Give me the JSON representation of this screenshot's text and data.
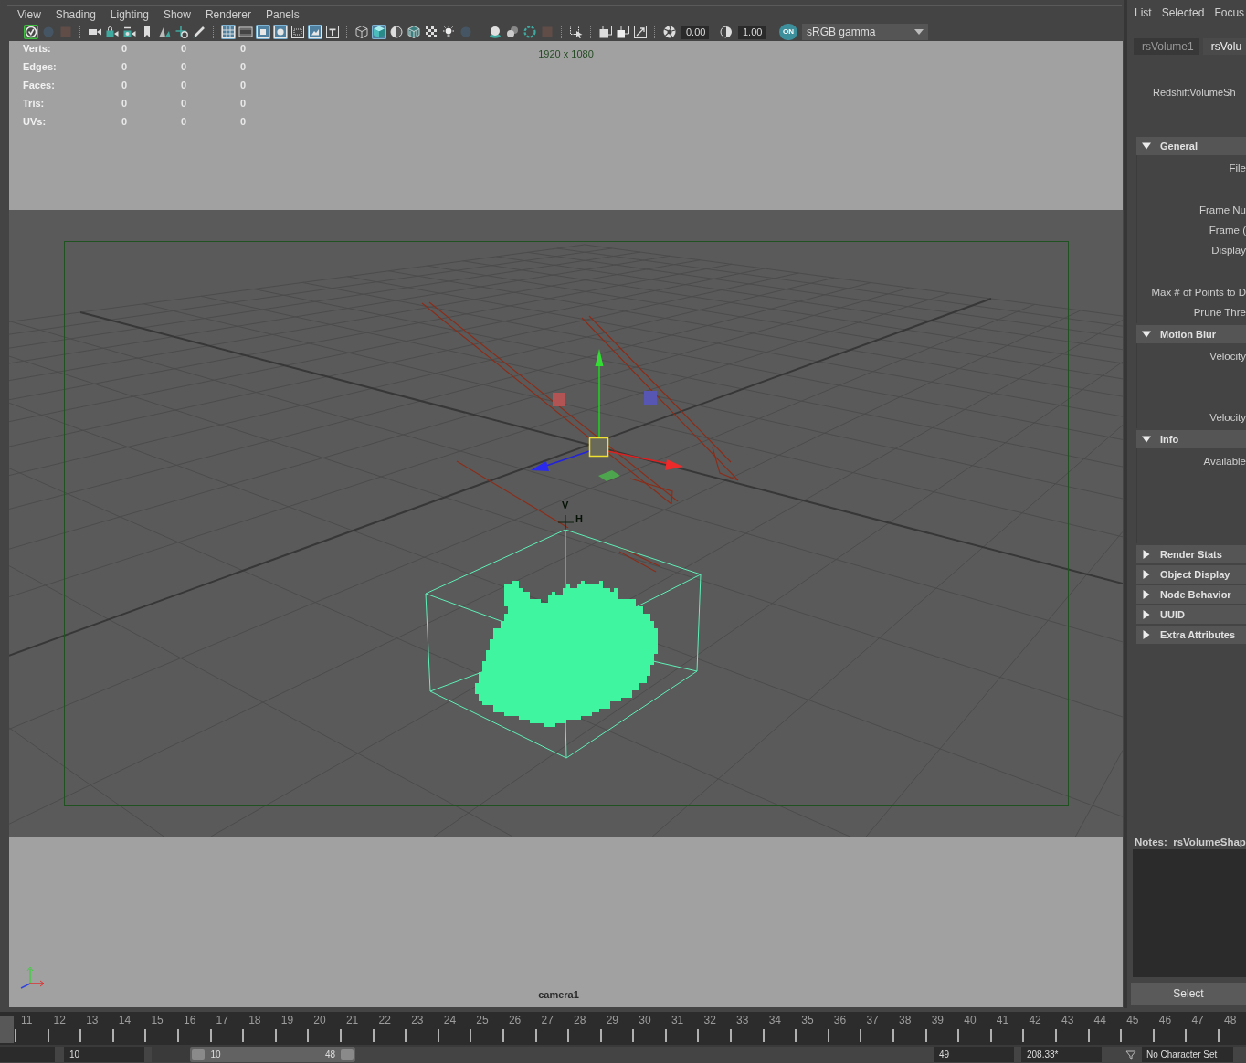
{
  "viewport": {
    "menu": [
      "View",
      "Shading",
      "Lighting",
      "Show",
      "Renderer",
      "Panels"
    ],
    "toolbar": {
      "groups": [
        [
          {
            "kind": "select-camera",
            "on": true,
            "disabled": false
          },
          {
            "kind": "dot",
            "on": false,
            "disabled": true
          },
          {
            "kind": "square",
            "on": false,
            "disabled": true
          }
        ],
        [
          {
            "kind": "camera",
            "on": false,
            "disabled": false
          },
          {
            "kind": "camera-lock",
            "on": false,
            "disabled": false
          },
          {
            "kind": "camera-rotate",
            "on": false,
            "disabled": false
          },
          {
            "kind": "bookmark",
            "on": false,
            "disabled": false
          },
          {
            "kind": "plane",
            "on": false,
            "disabled": false
          },
          {
            "kind": "move-zoom",
            "on": false,
            "disabled": false
          },
          {
            "kind": "pencil",
            "on": false,
            "disabled": false
          }
        ],
        [
          {
            "kind": "grid",
            "on": true,
            "disabled": false
          },
          {
            "kind": "film-gate",
            "on": false,
            "disabled": false
          },
          {
            "kind": "res-gate",
            "on": true,
            "disabled": false
          },
          {
            "kind": "gate-mask",
            "on": true,
            "disabled": false
          },
          {
            "kind": "field-chart",
            "on": false,
            "disabled": false
          },
          {
            "kind": "safe-action",
            "on": true,
            "disabled": false
          },
          {
            "kind": "safe-title",
            "on": false,
            "disabled": false
          }
        ],
        [
          {
            "kind": "wire-cube",
            "on": false,
            "disabled": false
          },
          {
            "kind": "shaded-cube",
            "on": true,
            "disabled": false
          },
          {
            "kind": "half-circle",
            "on": false,
            "disabled": false
          },
          {
            "kind": "textured-cube",
            "on": false,
            "disabled": false
          },
          {
            "kind": "checker",
            "on": false,
            "disabled": false
          },
          {
            "kind": "bulb",
            "on": false,
            "disabled": false
          },
          {
            "kind": "dot",
            "on": false,
            "disabled": true
          }
        ],
        [
          {
            "kind": "sphere",
            "on": false,
            "disabled": false
          },
          {
            "kind": "spheres",
            "on": false,
            "disabled": false
          },
          {
            "kind": "ring",
            "on": false,
            "disabled": false
          },
          {
            "kind": "square",
            "on": false,
            "disabled": true
          }
        ],
        [
          {
            "kind": "select-box",
            "on": false,
            "disabled": false
          }
        ],
        [
          {
            "kind": "stacked-squares",
            "on": false,
            "disabled": false
          },
          {
            "kind": "squares",
            "on": false,
            "disabled": false
          },
          {
            "kind": "arrow-box",
            "on": false,
            "disabled": false
          }
        ]
      ],
      "exposure": "0.00",
      "gamma": "1.00",
      "color_management": {
        "label": "ON",
        "on": true
      },
      "view_transform": "sRGB gamma"
    },
    "hud": [
      {
        "label": "Verts:",
        "values": [
          "0",
          "0",
          "0"
        ]
      },
      {
        "label": "Edges:",
        "values": [
          "0",
          "0",
          "0"
        ]
      },
      {
        "label": "Faces:",
        "values": [
          "0",
          "0",
          "0"
        ]
      },
      {
        "label": "Tris:",
        "values": [
          "0",
          "0",
          "0"
        ]
      },
      {
        "label": "UVs:",
        "values": [
          "0",
          "0",
          "0"
        ]
      }
    ],
    "resolution": "1920 x 1080",
    "handle_labels": [
      "V",
      "H"
    ],
    "camera": "camera1"
  },
  "attribute_editor": {
    "menu": [
      "List",
      "Selected",
      "Focus"
    ],
    "tabs": [
      {
        "label": "rsVolume1",
        "selected": false
      },
      {
        "label": "rsVolu",
        "selected": true
      }
    ],
    "node_type": "RedshiftVolumeSh",
    "sections": [
      {
        "title": "General",
        "expanded": true,
        "rows": [
          {
            "label": "File",
            "kind": "double"
          },
          {
            "label": "Frame Nu",
            "kind": "line"
          },
          {
            "label": "Frame (",
            "kind": "line"
          },
          {
            "label": "Display",
            "kind": "double"
          },
          {
            "label": "Max # of Points to D",
            "kind": "line"
          },
          {
            "label": "Prune Thre",
            "kind": "line"
          }
        ]
      },
      {
        "title": "Motion Blur",
        "expanded": true,
        "rows": [
          {
            "label": "Velocity",
            "kind": "triple"
          },
          {
            "label": "Velocity",
            "kind": "line"
          }
        ]
      },
      {
        "title": "Info",
        "expanded": true,
        "rows": [
          {
            "label": "Available",
            "kind": "box"
          }
        ]
      },
      {
        "title": "Render Stats",
        "expanded": false
      },
      {
        "title": "Object Display",
        "expanded": false
      },
      {
        "title": "Node Behavior",
        "expanded": false
      },
      {
        "title": "UUID",
        "expanded": false
      },
      {
        "title": "Extra Attributes",
        "expanded": false
      }
    ],
    "notes_label": "Notes:  rsVolumeShap",
    "select_button": "Select"
  },
  "timeline": {
    "level": 0,
    "frames": [
      "11",
      "12",
      "13",
      "14",
      "15",
      "16",
      "17",
      "18",
      "19",
      "20",
      "21",
      "22",
      "23",
      "24",
      "25",
      "26",
      "27",
      "28",
      "29",
      "30",
      "31",
      "32",
      "33",
      "34",
      "35",
      "36",
      "37",
      "38",
      "39",
      "40",
      "41",
      "42",
      "43",
      "44",
      "45",
      "46",
      "47",
      "48"
    ]
  },
  "range_bar": {
    "start_field": "10",
    "level": 0.81,
    "slider_start": "10",
    "slider_end": "48",
    "end_fields": [
      "49",
      "208.33*"
    ],
    "character_set": "No Character Set"
  }
}
